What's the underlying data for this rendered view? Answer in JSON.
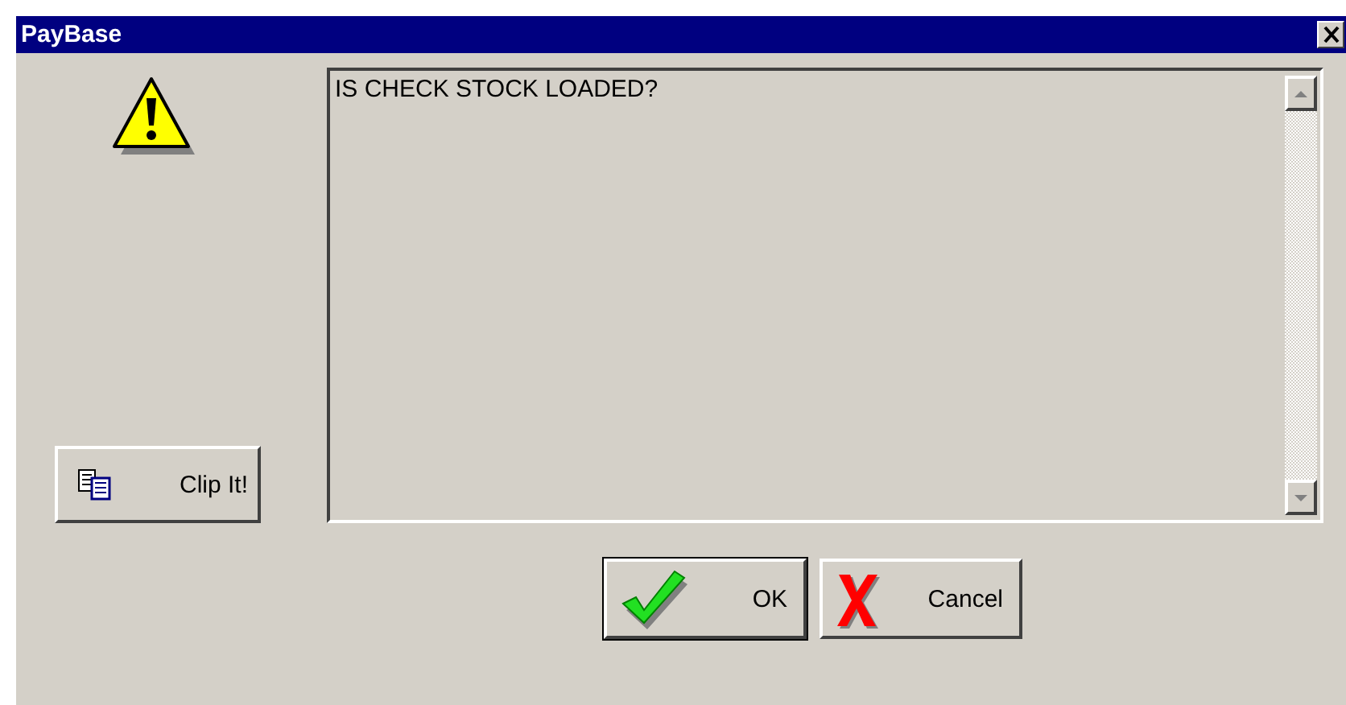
{
  "window": {
    "title": "PayBase"
  },
  "message": {
    "text": "IS CHECK STOCK LOADED?"
  },
  "clip_button": {
    "label": "Clip It!"
  },
  "buttons": [
    {
      "label": "OK",
      "kind": "ok",
      "default": true
    },
    {
      "label": "Cancel",
      "kind": "cancel",
      "default": false
    }
  ]
}
